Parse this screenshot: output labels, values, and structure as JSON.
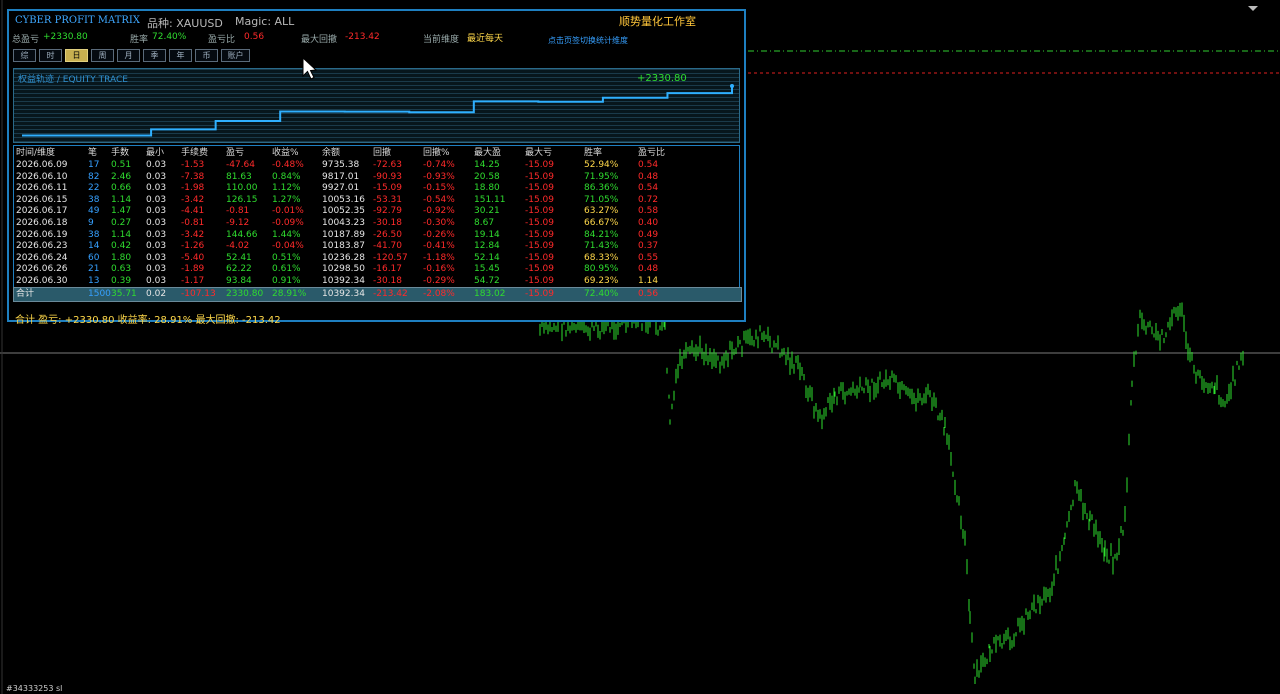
{
  "panel": {
    "title": "CYBER PROFIT MATRIX",
    "symbol_label": "品种: XAUUSD",
    "magic_label": "Magic: ALL",
    "studio": "顺势量化工作室",
    "total_profit_label": "总盈亏",
    "total_profit_value": "+2330.80",
    "winrate_label": "胜率",
    "winrate_value": "72.40%",
    "pl_ratio_label": "盈亏比",
    "pl_ratio_value": "0.56",
    "max_dd_label": "最大回撤",
    "max_dd_value": "-213.42",
    "dimension_label": "当前维度",
    "dimension_value": "最近每天",
    "hint": "点击页签切换统计维度",
    "tabs": [
      "综",
      "时",
      "日",
      "周",
      "月",
      "季",
      "年",
      "币",
      "账户"
    ],
    "active_tab": 2,
    "equity_title": "权益轨迹 / EQUITY TRACE",
    "equity_value": "+2330.80",
    "headers": [
      "时间/维度",
      "笔",
      "手数",
      "最小",
      "手续费",
      "盈亏",
      "收益%",
      "余额",
      "回撤",
      "回撤%",
      "最大盈",
      "最大亏",
      "胜率",
      "盈亏比"
    ],
    "rows": [
      [
        "2026.06.09",
        "17",
        "0.51",
        "0.03",
        "-1.53",
        "-47.64",
        "-0.48%",
        "9735.38",
        "-72.63",
        "-0.74%",
        "14.25",
        "-15.09",
        "52.94%",
        "0.54"
      ],
      [
        "2026.06.10",
        "82",
        "2.46",
        "0.03",
        "-7.38",
        "81.63",
        "0.84%",
        "9817.01",
        "-90.93",
        "-0.93%",
        "20.58",
        "-15.09",
        "71.95%",
        "0.48"
      ],
      [
        "2026.06.11",
        "22",
        "0.66",
        "0.03",
        "-1.98",
        "110.00",
        "1.12%",
        "9927.01",
        "-15.09",
        "-0.15%",
        "18.80",
        "-15.09",
        "86.36%",
        "0.54"
      ],
      [
        "2026.06.15",
        "38",
        "1.14",
        "0.03",
        "-3.42",
        "126.15",
        "1.27%",
        "10053.16",
        "-53.31",
        "-0.54%",
        "151.11",
        "-15.09",
        "71.05%",
        "0.72"
      ],
      [
        "2026.06.17",
        "49",
        "1.47",
        "0.03",
        "-4.41",
        "-0.81",
        "-0.01%",
        "10052.35",
        "-92.79",
        "-0.92%",
        "30.21",
        "-15.09",
        "63.27%",
        "0.58"
      ],
      [
        "2026.06.18",
        "9",
        "0.27",
        "0.03",
        "-0.81",
        "-9.12",
        "-0.09%",
        "10043.23",
        "-30.18",
        "-0.30%",
        "8.67",
        "-15.09",
        "66.67%",
        "0.40"
      ],
      [
        "2026.06.19",
        "38",
        "1.14",
        "0.03",
        "-3.42",
        "144.66",
        "1.44%",
        "10187.89",
        "-26.50",
        "-0.26%",
        "19.14",
        "-15.09",
        "84.21%",
        "0.49"
      ],
      [
        "2026.06.23",
        "14",
        "0.42",
        "0.03",
        "-1.26",
        "-4.02",
        "-0.04%",
        "10183.87",
        "-41.70",
        "-0.41%",
        "12.84",
        "-15.09",
        "71.43%",
        "0.37"
      ],
      [
        "2026.06.24",
        "60",
        "1.80",
        "0.03",
        "-5.40",
        "52.41",
        "0.51%",
        "10236.28",
        "-120.57",
        "-1.18%",
        "52.14",
        "-15.09",
        "68.33%",
        "0.55"
      ],
      [
        "2026.06.26",
        "21",
        "0.63",
        "0.03",
        "-1.89",
        "62.22",
        "0.61%",
        "10298.50",
        "-16.17",
        "-0.16%",
        "15.45",
        "-15.09",
        "80.95%",
        "0.48"
      ],
      [
        "2026.06.30",
        "13",
        "0.39",
        "0.03",
        "-1.17",
        "93.84",
        "0.91%",
        "10392.34",
        "-30.18",
        "-0.29%",
        "54.72",
        "-15.09",
        "69.23%",
        "1.14"
      ]
    ],
    "total_row": [
      "合计",
      "1500",
      "35.71",
      "0.02",
      "-107.13",
      "2330.80",
      "28.91%",
      "10392.34",
      "-213.42",
      "-2.08%",
      "183.02",
      "-15.09",
      "72.40%",
      "0.56"
    ],
    "footer": "合计  盈亏: +2330.80    收益率: 28.91%    最大回撤: -213.42"
  },
  "status": {
    "bottom_left": "#34333253 sl"
  },
  "colors": {
    "profit": "#2fdc2f",
    "loss": "#ff2a2a",
    "accent": "#ffd84a",
    "border": "#1e7fc0"
  }
}
